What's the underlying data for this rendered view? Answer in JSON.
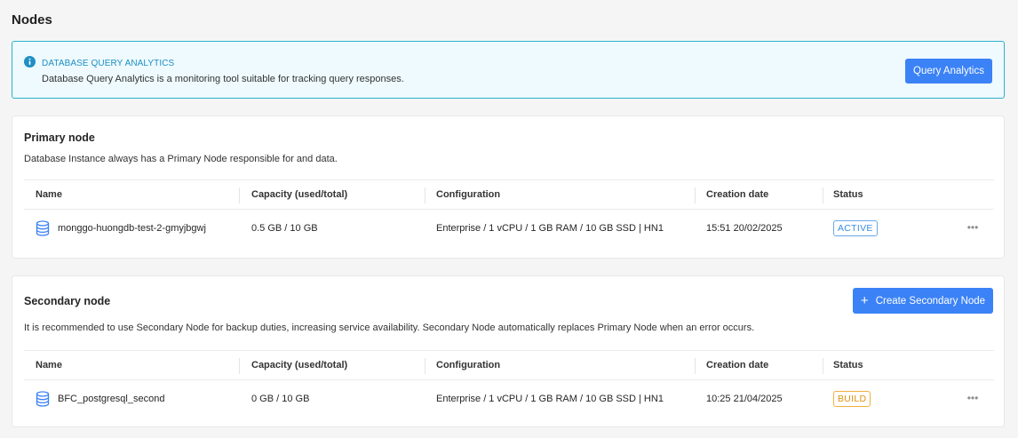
{
  "page": {
    "title": "Nodes"
  },
  "banner": {
    "title": "DATABASE QUERY ANALYTICS",
    "text": "Database Query Analytics is a monitoring tool suitable for tracking query responses.",
    "button_label": "Query Analytics"
  },
  "columns": [
    "Name",
    "Capacity (used/total)",
    "Configuration",
    "Creation date",
    "Status"
  ],
  "primary": {
    "title": "Primary node",
    "description": "Database Instance always has a Primary Node responsible for and data.",
    "rows": [
      {
        "name": "monggo-huongdb-test-2-gmyjbgwj",
        "capacity": "0.5 GB / 10 GB",
        "configuration": "Enterprise / 1 vCPU / 1 GB RAM / 10 GB SSD | HN1",
        "created": "15:51 20/02/2025",
        "status": "ACTIVE",
        "more": "•••"
      }
    ]
  },
  "secondary": {
    "title": "Secondary node",
    "description": "It is recommended to use Secondary Node for backup duties, increasing service availability. Secondary Node automatically replaces Primary Node when an error occurs.",
    "create_button_label": "Create Secondary Node",
    "create_button_icon": "+",
    "rows": [
      {
        "name": "BFC_postgresql_second",
        "capacity": "0 GB / 10 GB",
        "configuration": "Enterprise / 1 vCPU / 1 GB RAM / 10 GB SSD | HN1",
        "created": "10:25 21/04/2025",
        "status": "BUILD",
        "more": "•••"
      }
    ]
  },
  "colors": {
    "accent": "#3b82f6",
    "banner_border": "#2bb3cc",
    "status_active": "#3a8ee6",
    "status_build": "#e0900e"
  },
  "icons": {
    "banner": "info-icon",
    "row": "database-icon",
    "row_action": "more-horizontal-icon",
    "create": "plus-icon"
  }
}
